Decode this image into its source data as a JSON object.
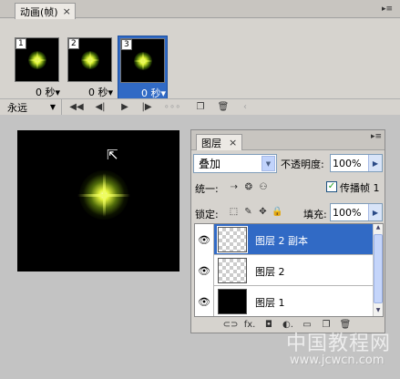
{
  "animation_panel": {
    "tab_label": "动画(帧)",
    "close_glyph": "×",
    "menu_glyph": "▸≡",
    "frames": [
      {
        "number": "1",
        "delay": "0 秒▾",
        "selected": false
      },
      {
        "number": "2",
        "delay": "0 秒▾",
        "selected": false
      },
      {
        "number": "3",
        "delay": "0 秒▾",
        "selected": true
      }
    ],
    "loop_option": "永远",
    "controls": {
      "first_frame": "◀◀",
      "prev_frame": "◀|",
      "play": "▶",
      "next_frame": "|▶",
      "tween": "∘∘∘",
      "duplicate": "❐",
      "delete": "🗑",
      "expand": "‹"
    }
  },
  "canvas": {
    "cursor_glyph": "⇱"
  },
  "layers_panel": {
    "tab_label": "图层",
    "close_glyph": "×",
    "menu_glyph": "▸≡",
    "blend_mode": "叠加",
    "opacity_label": "不透明度:",
    "opacity_value": "100%",
    "unify_label": "统一:",
    "unify_icons": [
      "⇢",
      "❂",
      "⚇"
    ],
    "propagate_label": "传播帧 1",
    "propagate_checked": "✓",
    "lock_label": "锁定:",
    "lock_icons": [
      "⬚",
      "✎",
      "✥",
      "🔒"
    ],
    "fill_label": "填充:",
    "fill_value": "100%",
    "arrow_glyph": "▶",
    "layers": [
      {
        "name": "图层 2 副本",
        "eye": "👁",
        "selected": true,
        "thumb": "transparent"
      },
      {
        "name": "图层 2",
        "eye": "👁",
        "selected": false,
        "thumb": "transparent"
      },
      {
        "name": "图层 1",
        "eye": "👁",
        "selected": false,
        "thumb": "black"
      }
    ],
    "bottom_icons": [
      "⊂⊃",
      "fx.",
      "◘",
      "◐.",
      "▭",
      "❐",
      "🗑"
    ]
  },
  "watermark": {
    "chinese": "中国教程网",
    "url": "www.jcwcn.com"
  },
  "colors": {
    "selection_blue": "#316ac5",
    "panel_gray": "#d6d3ce",
    "background_gray": "#c3c3c3",
    "star_yellow_green": "#e4f43c"
  }
}
